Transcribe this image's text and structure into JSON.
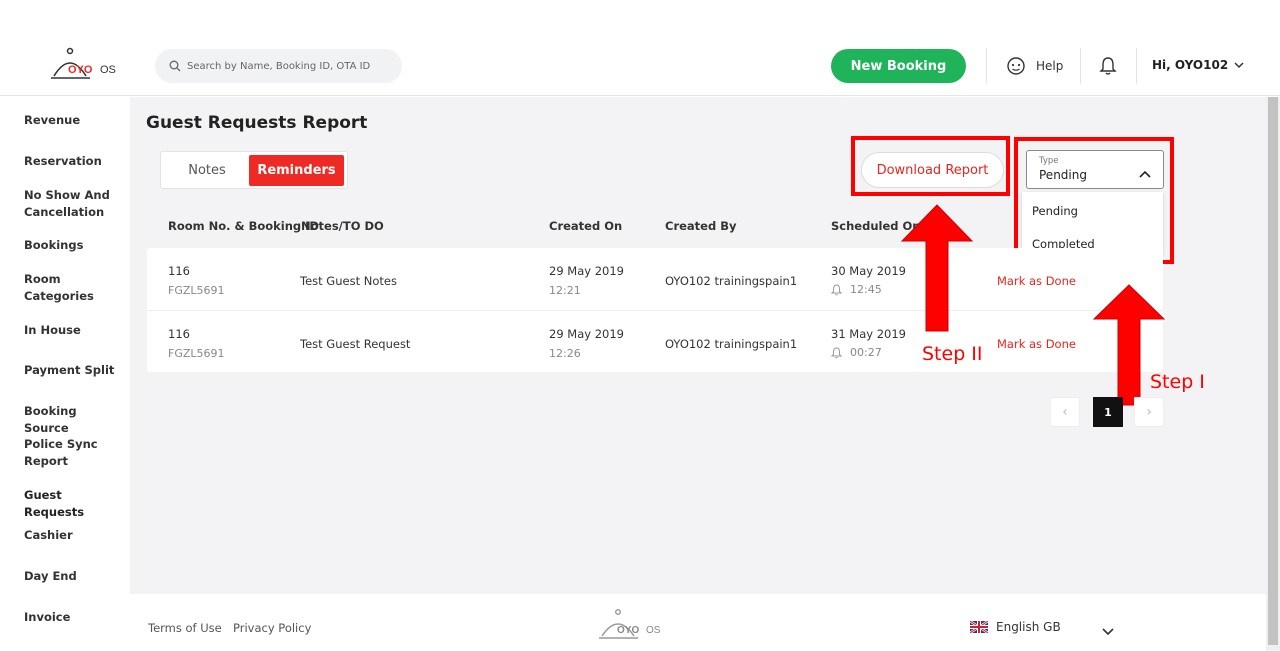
{
  "header": {
    "logo_text": "OYO OS",
    "search_placeholder": "Search by Name, Booking ID, OTA ID",
    "new_booking": "New Booking",
    "help": "Help",
    "user": "Hi, OYO102"
  },
  "sidebar": {
    "items": [
      "Revenue",
      "Reservation",
      "No Show And Cancellation",
      "Bookings",
      "Room Categories",
      "In House",
      "Payment Split",
      "Booking Source",
      "Police Sync Report",
      "Guest Requests",
      "Cashier",
      "Day End",
      "Invoice"
    ]
  },
  "main": {
    "title": "Guest Requests Report",
    "tabs": [
      "Notes",
      "Reminders"
    ],
    "download": "Download Report",
    "type_filter": {
      "label": "Type",
      "value": "Pending",
      "options": [
        "Pending",
        "Completed"
      ]
    },
    "columns": [
      "Room No. & Booking ID",
      "Notes/TO DO",
      "Created On",
      "Created By",
      "Scheduled On"
    ],
    "rows": [
      {
        "room": "116",
        "booking_id": "FGZL5691",
        "note": "Test Guest Notes",
        "created_date": "29 May 2019",
        "created_time": "12:21",
        "created_by": "OYO102 trainingspain1",
        "sched_date": "30 May 2019",
        "sched_time": "12:45",
        "action": "Mark as Done"
      },
      {
        "room": "116",
        "booking_id": "FGZL5691",
        "note": "Test Guest Request",
        "created_date": "29 May 2019",
        "created_time": "12:26",
        "created_by": "OYO102 trainingspain1",
        "sched_date": "31 May 2019",
        "sched_time": "00:27",
        "action": "Mark as Done"
      }
    ],
    "pagination": {
      "current": "1"
    },
    "annotations": {
      "step1": "Step I",
      "step2": "Step II",
      "color": "#ff0000"
    }
  },
  "footer": {
    "terms": "Terms of Use",
    "privacy": "Privacy Policy",
    "language": "English GB"
  },
  "colors": {
    "brand_red": "#ee2a24",
    "new_booking_green": "#1fb35a"
  }
}
